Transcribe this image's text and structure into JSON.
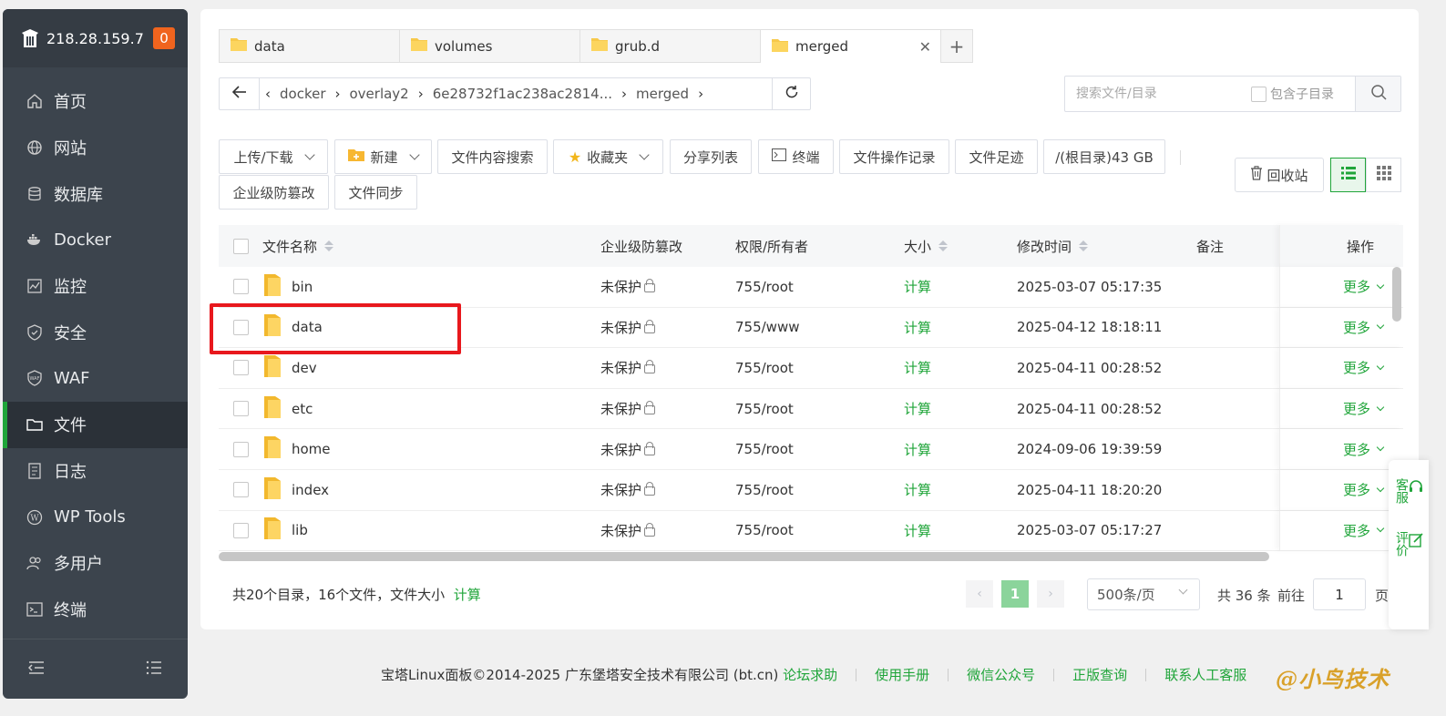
{
  "sidebar": {
    "ip": "218.28.159.7",
    "badge": "0",
    "items": [
      {
        "label": "首页",
        "icon": "home-icon"
      },
      {
        "label": "网站",
        "icon": "globe-icon"
      },
      {
        "label": "数据库",
        "icon": "database-icon"
      },
      {
        "label": "Docker",
        "icon": "docker-icon"
      },
      {
        "label": "监控",
        "icon": "monitor-icon"
      },
      {
        "label": "安全",
        "icon": "shield-icon"
      },
      {
        "label": "WAF",
        "icon": "waf-icon"
      },
      {
        "label": "文件",
        "icon": "folder-icon"
      },
      {
        "label": "日志",
        "icon": "log-icon"
      },
      {
        "label": "WP Tools",
        "icon": "wordpress-icon"
      },
      {
        "label": "多用户",
        "icon": "users-icon"
      },
      {
        "label": "终端",
        "icon": "terminal-icon"
      }
    ],
    "active": "文件"
  },
  "tabs": [
    "data",
    "volumes",
    "grub.d",
    "merged"
  ],
  "path": [
    "docker",
    "overlay2",
    "6e28732f1ac238ac2814...",
    "merged"
  ],
  "search": {
    "placeholder": "搜索文件/目录",
    "subdir_label": "包含子目录"
  },
  "toolbar": {
    "upload": "上传/下载",
    "new": "新建",
    "content_search": "文件内容搜索",
    "favorites": "收藏夹",
    "share_list": "分享列表",
    "terminal": "终端",
    "op_log": "文件操作记录",
    "footprint": "文件足迹",
    "disk": "/(根目录)43 GB",
    "tamper": "企业级防篡改",
    "sync": "文件同步",
    "recycle": "回收站"
  },
  "table": {
    "headers": {
      "name": "文件名称",
      "protect": "企业级防篡改",
      "perm": "权限/所有者",
      "size": "大小",
      "mtime": "修改时间",
      "note": "备注",
      "op": "操作"
    },
    "rows": [
      {
        "name": "bin",
        "protect": "未保护",
        "perm": "755/root",
        "size": "计算",
        "mtime": "2025-03-07 05:17:35",
        "op": "更多"
      },
      {
        "name": "data",
        "protect": "未保护",
        "perm": "755/www",
        "size": "计算",
        "mtime": "2025-04-12 18:18:11",
        "op": "更多"
      },
      {
        "name": "dev",
        "protect": "未保护",
        "perm": "755/root",
        "size": "计算",
        "mtime": "2025-04-11 00:28:52",
        "op": "更多"
      },
      {
        "name": "etc",
        "protect": "未保护",
        "perm": "755/root",
        "size": "计算",
        "mtime": "2025-04-11 00:28:52",
        "op": "更多"
      },
      {
        "name": "home",
        "protect": "未保护",
        "perm": "755/root",
        "size": "计算",
        "mtime": "2024-09-06 19:39:59",
        "op": "更多"
      },
      {
        "name": "index",
        "protect": "未保护",
        "perm": "755/root",
        "size": "计算",
        "mtime": "2025-04-11 18:20:20",
        "op": "更多"
      },
      {
        "name": "lib",
        "protect": "未保护",
        "perm": "755/root",
        "size": "计算",
        "mtime": "2025-03-07 05:17:27",
        "op": "更多"
      }
    ]
  },
  "footer": {
    "summary": "共20个目录，16个文件，文件大小",
    "calc": "计算",
    "current_page": "1",
    "per_page": "500条/页",
    "total": "共 36 条",
    "goto_label": "前往",
    "goto_value": "1",
    "page_unit": "页"
  },
  "bottom": {
    "copyright": "宝塔Linux面板©2014-2025 广东堡塔安全技术有限公司 (bt.cn)",
    "links": [
      "论坛求助",
      "使用手册",
      "微信公众号",
      "正版查询",
      "联系人工客服"
    ],
    "watermark": "@小鸟技术"
  },
  "float": {
    "service": "客服",
    "review": "评价"
  },
  "colors": {
    "accent": "#20a53a",
    "sidebar": "#3c444d",
    "highlight": "#e8181d"
  }
}
